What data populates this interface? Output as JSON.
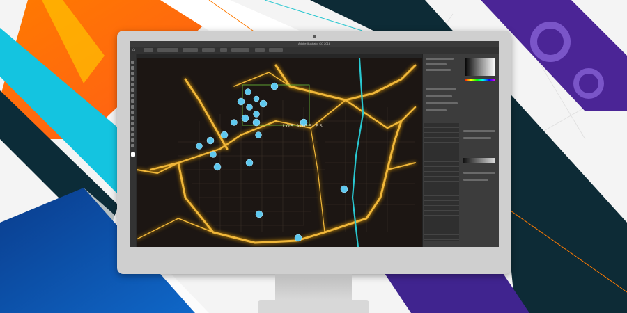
{
  "app": {
    "window_title": "Adobe Illustrator CC 2018"
  },
  "map": {
    "city_label": "LOS ANGELES"
  },
  "colors": {
    "road_glow": "#f0b73a",
    "river": "#29c7d0",
    "marker": "#5ec8ee",
    "selection": "#6fc33a"
  },
  "icons": [
    "home-icon",
    "selection-tool-icon",
    "pen-tool-icon",
    "type-tool-icon",
    "zoom-tool-icon",
    "layers-icon",
    "color-picker-icon"
  ]
}
